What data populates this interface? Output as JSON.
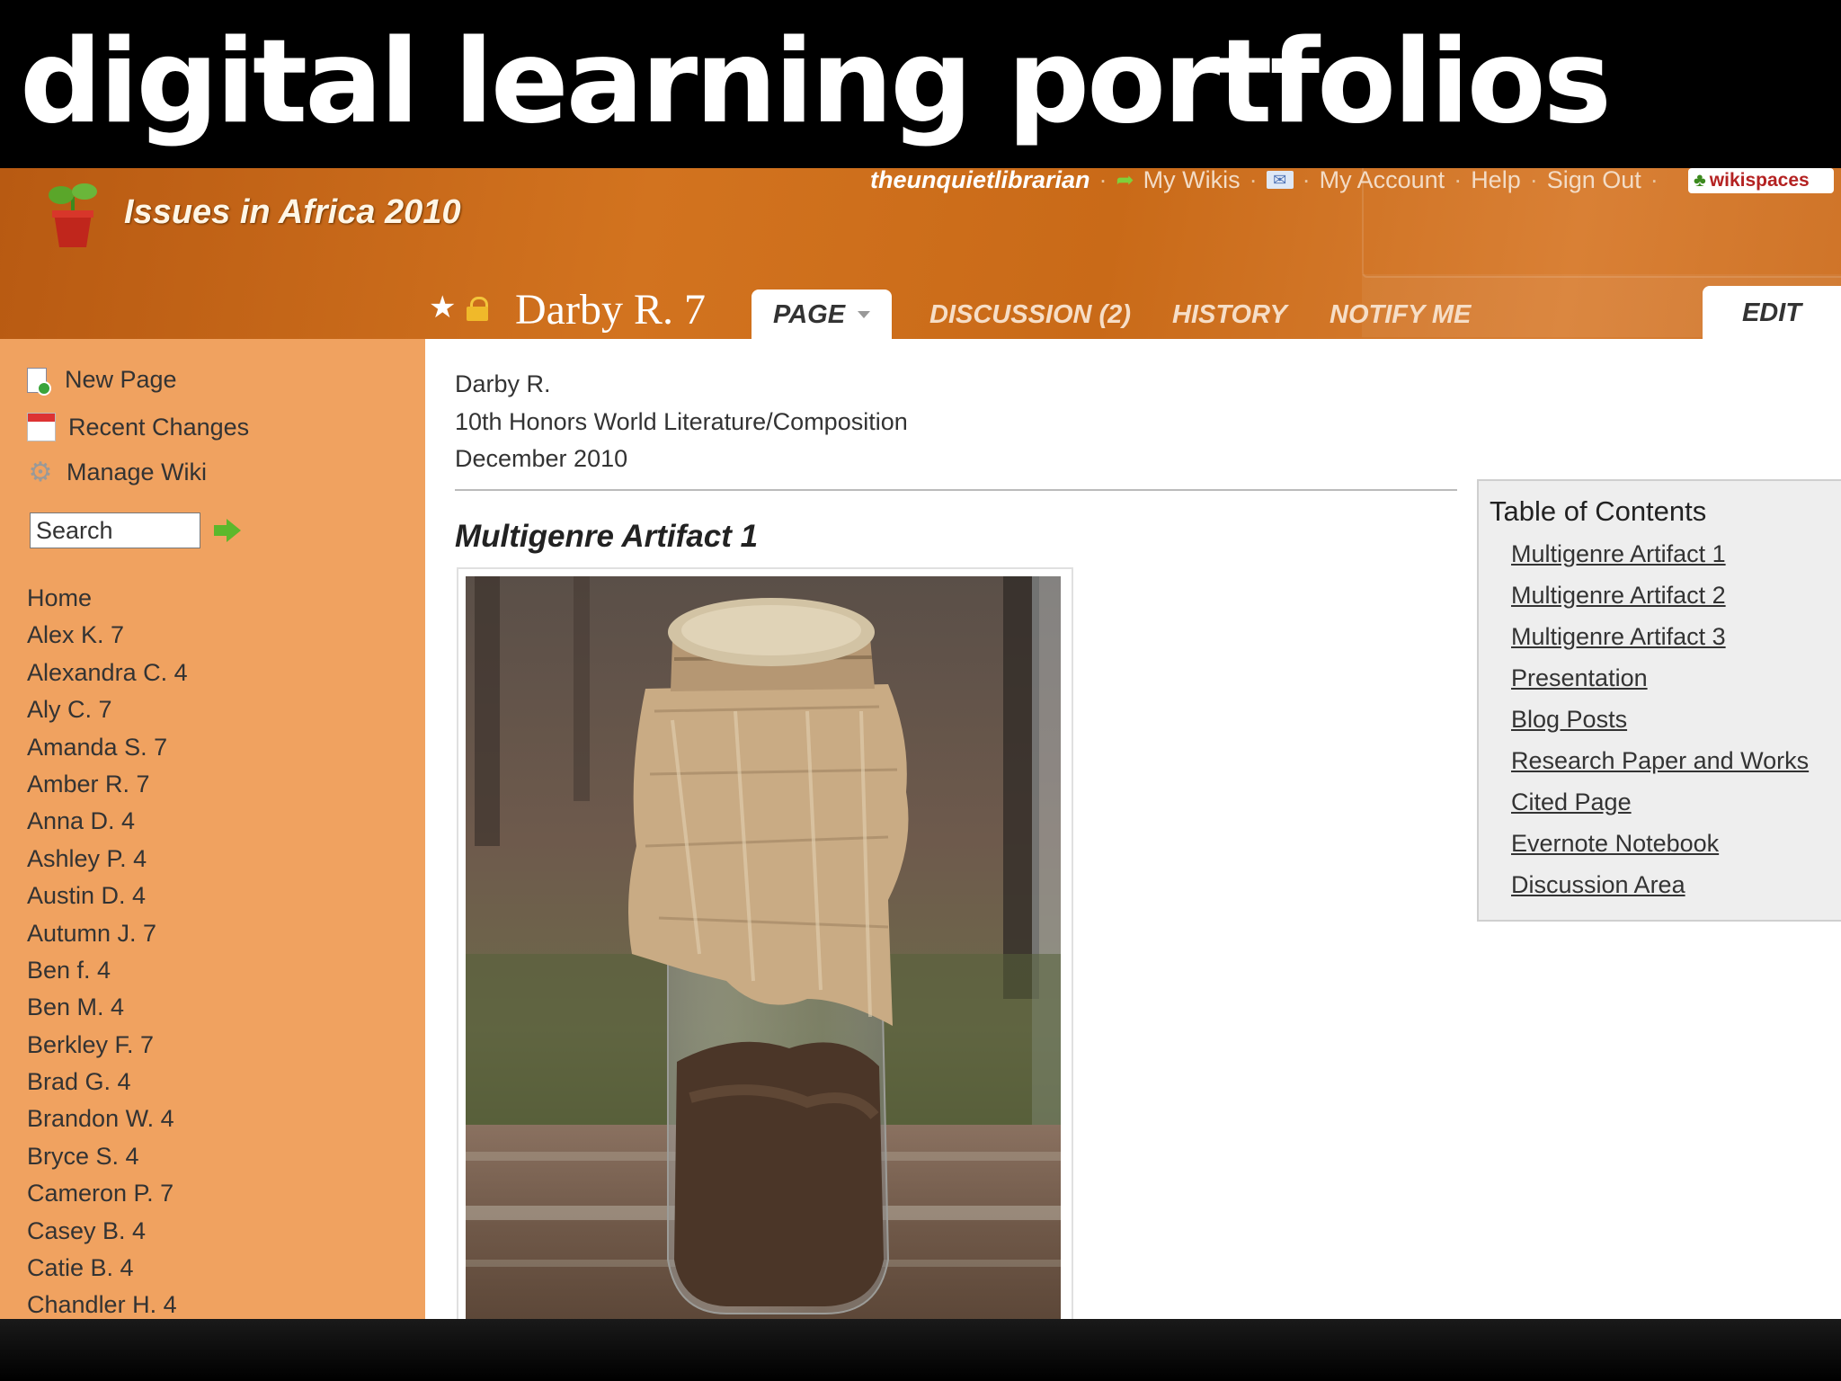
{
  "slide": {
    "title": "digital learning portfolios"
  },
  "header": {
    "wiki_name": "Issues in Africa 2010",
    "user": "theunquietlibrarian",
    "links": [
      "My Wikis",
      "My Account",
      "Help",
      "Sign Out"
    ],
    "wikispaces_label": "wikispaces",
    "icons": [
      "plant-logo-icon",
      "leaf-icon",
      "mail-icon",
      "star-icon",
      "lock-icon"
    ]
  },
  "page": {
    "title": "Darby R. 7",
    "tabs": [
      {
        "label": "PAGE",
        "active": true
      },
      {
        "label": "DISCUSSION (2)",
        "active": false
      },
      {
        "label": "HISTORY",
        "active": false
      },
      {
        "label": "NOTIFY ME",
        "active": false
      }
    ],
    "edit_label": "EDIT"
  },
  "sidebar": {
    "actions": [
      "New Page",
      "Recent Changes",
      "Manage Wiki"
    ],
    "search_value": "Search",
    "nav": [
      "Home",
      "Alex K. 7",
      "Alexandra C. 4",
      "Aly C. 7",
      "Amanda S. 7",
      "Amber R. 7",
      "Anna D. 4",
      "Ashley P. 4",
      "Austin D. 4",
      "Autumn J. 7",
      "Ben f. 4",
      "Ben M. 4",
      "Berkley F. 7",
      "Brad G. 4",
      "Brandon W. 4",
      "Bryce S. 4",
      "Cameron P. 7",
      "Casey B. 4",
      "Catie B. 4",
      "Chandler H. 4"
    ]
  },
  "content": {
    "meta": [
      "Darby R.",
      "10th Honors World Literature/Composition",
      "December 2010"
    ],
    "artifact_heading": "Multigenre Artifact 1"
  },
  "toc": {
    "title": "Table of Contents",
    "items": [
      "Multigenre Artifact 1",
      "Multigenre Artifact 2",
      "Multigenre Artifact 3",
      "Presentation",
      "Blog Posts",
      "Research Paper and Works",
      "Cited Page",
      "Evernote Notebook",
      "Discussion Area"
    ]
  },
  "colors": {
    "header_orange": "#cf7428",
    "sidebar_orange": "#f0a260",
    "toc_bg": "#eeeeee"
  }
}
